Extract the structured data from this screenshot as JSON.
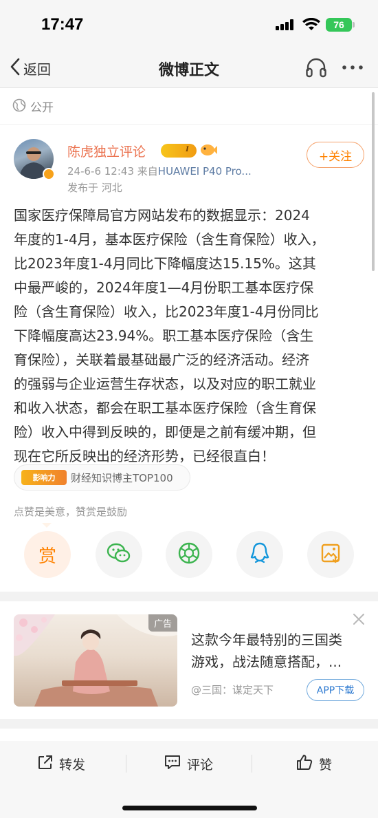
{
  "status_bar": {
    "time": "17:47",
    "battery": "76"
  },
  "nav": {
    "back_label": "返回",
    "title": "微博正文"
  },
  "visibility": {
    "label": "公开"
  },
  "author": {
    "name": "陈虎独立评论",
    "level": "I",
    "timestamp": "24-6-6 12:43",
    "source_prefix": "来自",
    "device": "HUAWEI P40 Pro...",
    "location": "发布于 河北",
    "follow_label": "+关注"
  },
  "post": {
    "lines": [
      "国家医疗保障局官方网站发布的数据显示：2024",
      "年度的1-4月，基本医疗保险（含生育保险）收入，",
      "比2023年度1-4月同比下降幅度达15.15%。这其",
      "中最严峻的，2024年度1—4月份职工基本医疗保",
      "险（含生育保险）收入，比2023年度1-4月份同比",
      "下降幅度高达23.94%。职工基本医疗保险（含生",
      "育保险），关联着最基础最广泛的经济活动。经济",
      "的强弱与企业运营生存状态，以及对应的职工就业",
      "和收入状态，都会在职工基本医疗保险（含生育保",
      "险）收入中得到反映的，即便是之前有缓冲期，但",
      "现在它所反映出的经济形势，已经很直白！"
    ]
  },
  "influence": {
    "logo_text": "影响力",
    "label": "财经知识博主TOP100"
  },
  "reward": {
    "hint": "点赞是美意，赞赏是鼓励",
    "button_label": "赏"
  },
  "ad": {
    "tag": "广告",
    "title_line1": "这款今年最特别的三国类",
    "title_line2": "游戏，战法随意搭配，...",
    "source": "@三国：谋定天下",
    "button_label": "APP下载"
  },
  "toolbar": {
    "repost_label": "转发",
    "comment_label": "评论",
    "like_label": "赞"
  },
  "colors": {
    "accent_orange": "#ff8200",
    "name_color": "#eb7350",
    "wechat_green": "#3cb44f",
    "qq_blue": "#1296db",
    "link_blue": "#2f7bd1"
  }
}
